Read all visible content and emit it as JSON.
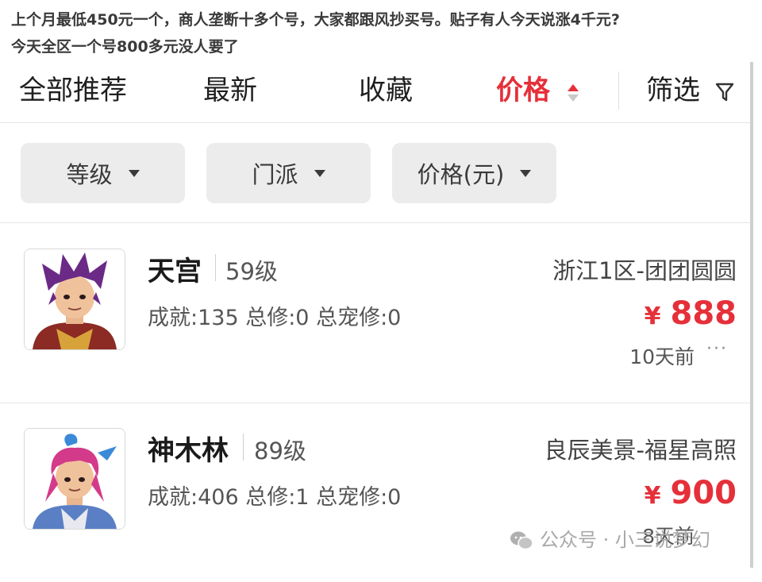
{
  "caption": {
    "line1": "上个月最低450元一个，商人垄断十多个号，大家都跟风抄买号。贴子有人今天说涨4千元?",
    "line2": "今天全区一个号800多元没人要了"
  },
  "tabs": [
    {
      "label": "全部推荐"
    },
    {
      "label": "最新"
    },
    {
      "label": "收藏"
    },
    {
      "label": "价格",
      "active": true
    },
    {
      "label": "筛选"
    }
  ],
  "filters": [
    {
      "label": "等级"
    },
    {
      "label": "门派"
    },
    {
      "label": "价格(元)"
    }
  ],
  "listings": [
    {
      "name": "天宫",
      "level": "59级",
      "stats": "成就:135 总修:0 总宠修:0",
      "server": "浙江1区-团团圆圆",
      "currency": "¥",
      "price": "888",
      "time": "10天前",
      "more": "···"
    },
    {
      "name": "神木林",
      "level": "89级",
      "stats": "成就:406 总修:1 总宠修:0",
      "server": "良辰美景-福星高照",
      "currency": "¥",
      "price": "900",
      "time": "8天前",
      "more": ""
    }
  ],
  "watermark": "公众号 · 小三说梦幻",
  "colors": {
    "accent": "#e5303a",
    "filter_bg": "#ececec",
    "divider": "#e6e6e6"
  }
}
